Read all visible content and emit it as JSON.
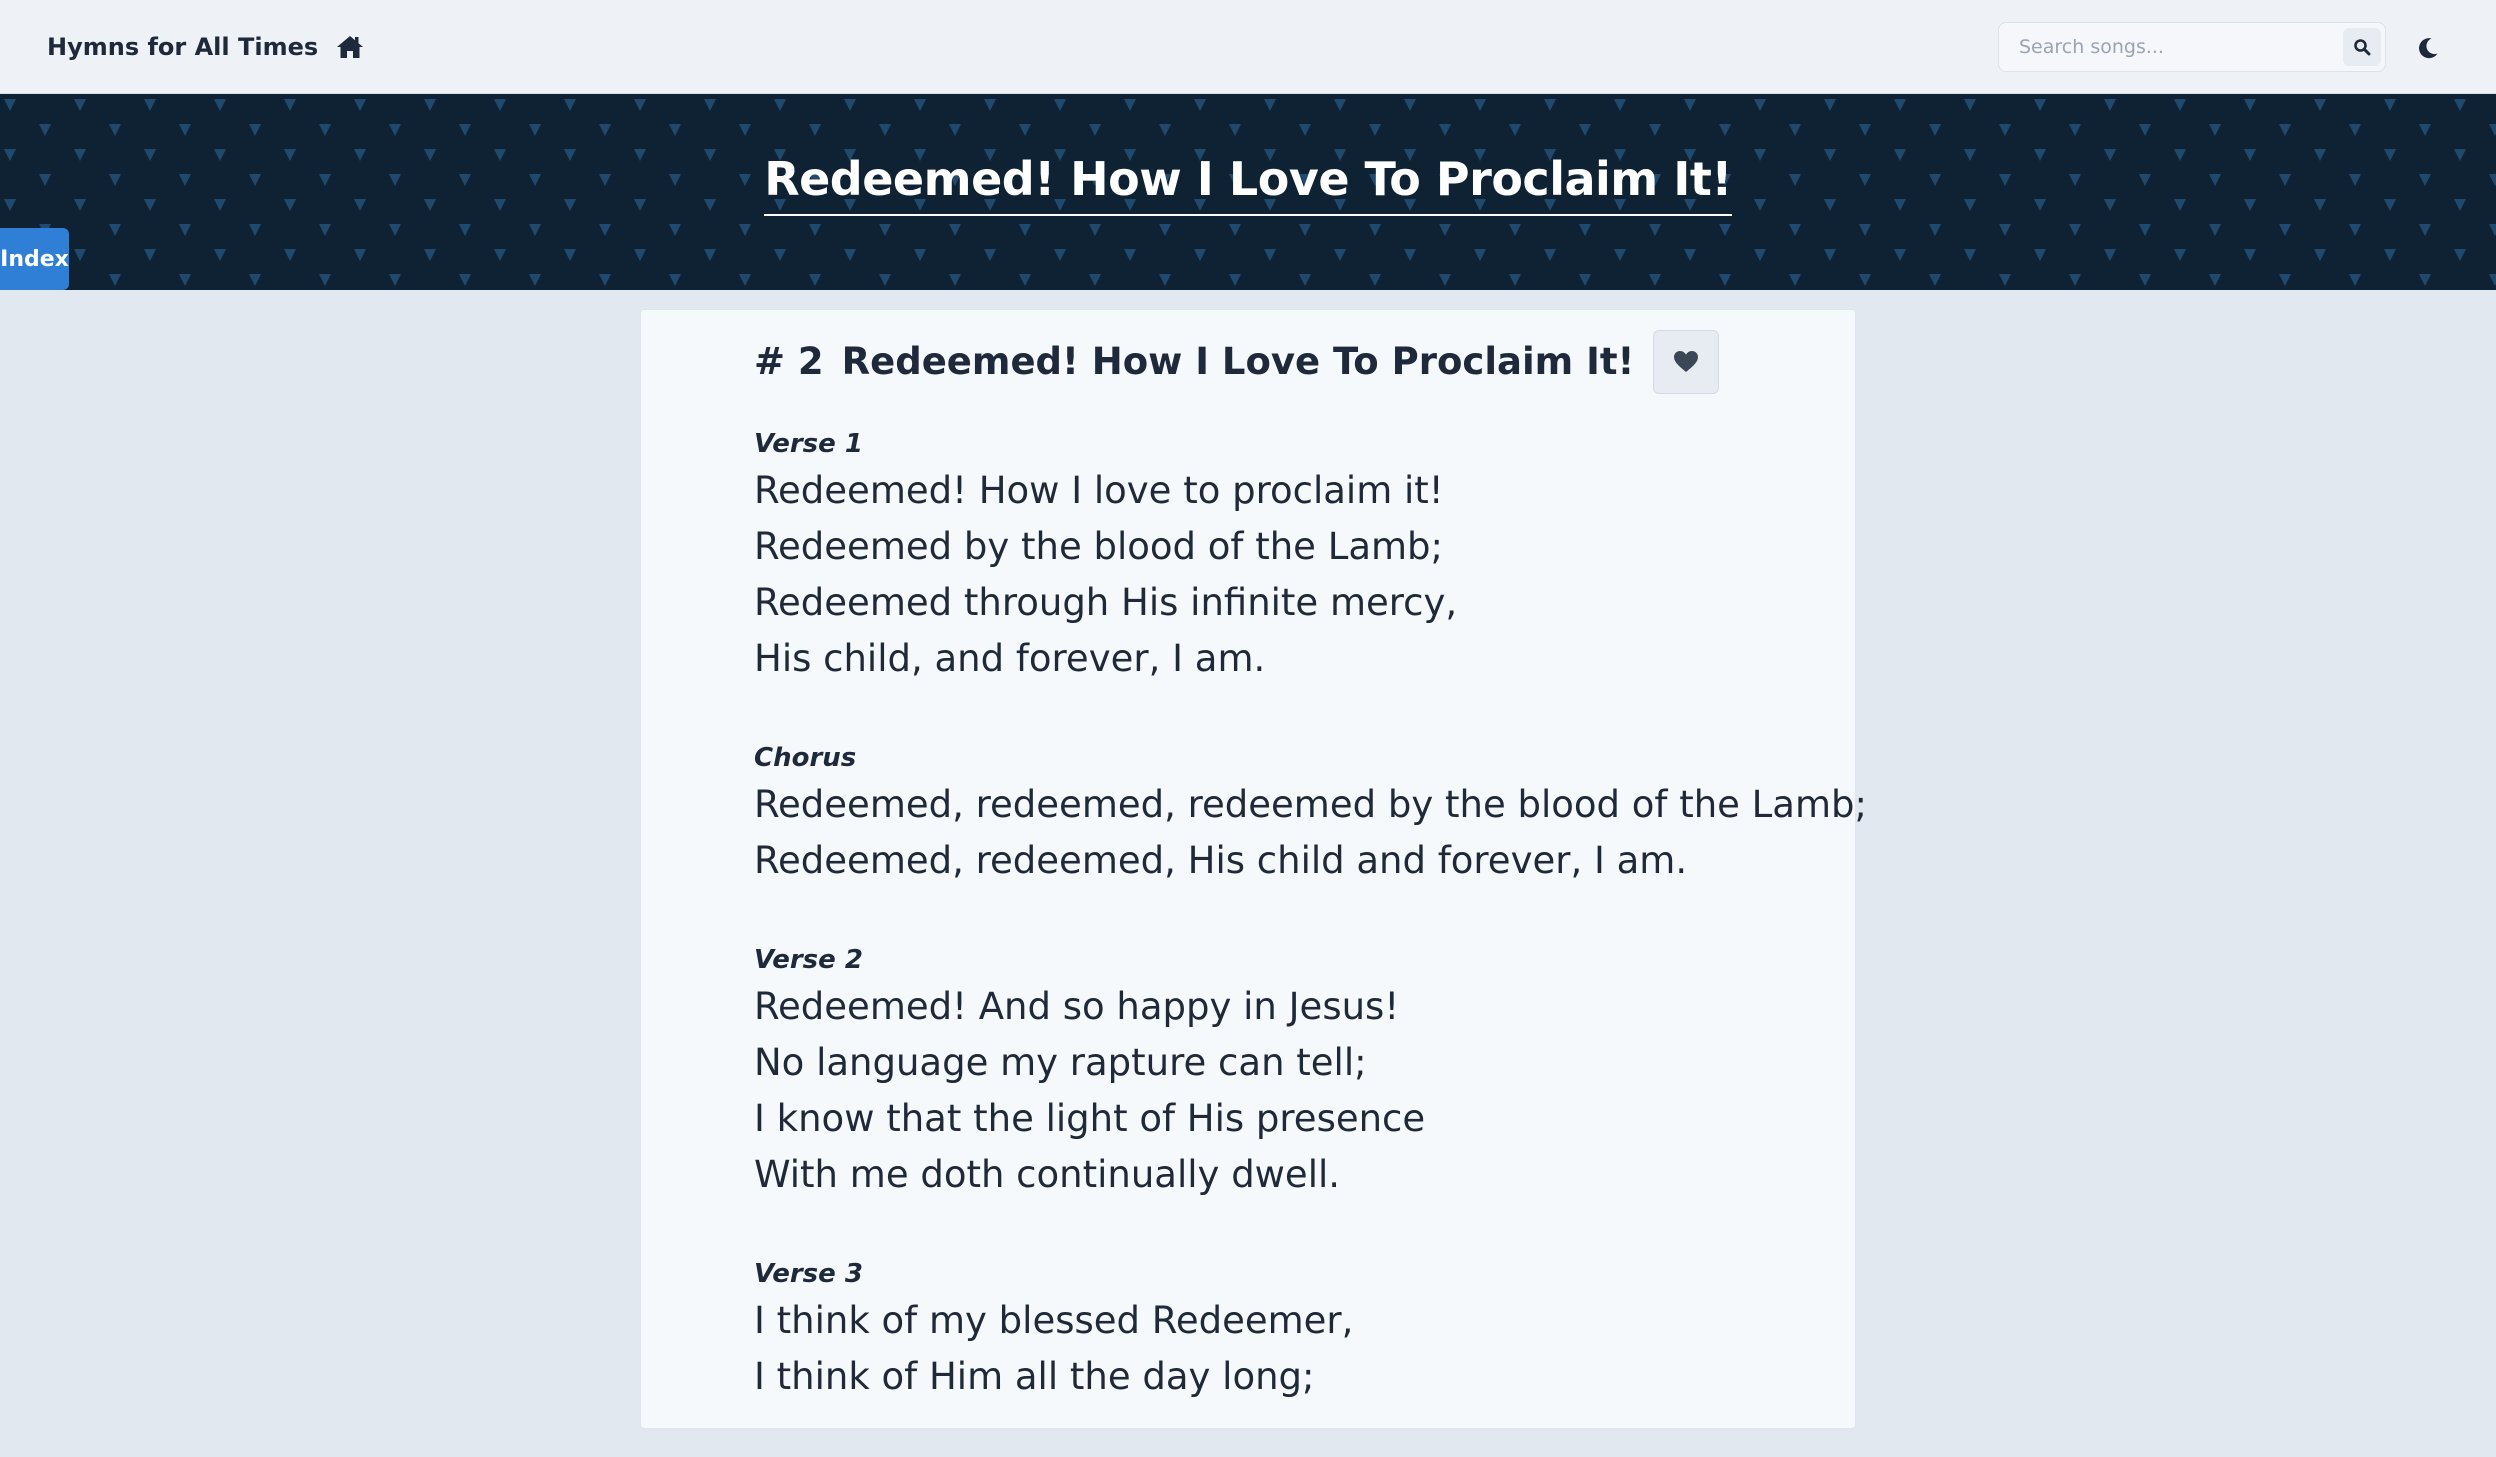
{
  "navbar": {
    "brand": "Hymns for All Times",
    "brand_icon": "home-icon",
    "search_placeholder": "Search songs...",
    "search_icon": "search-icon",
    "theme_icon": "moon-icon"
  },
  "hero": {
    "title": "Redeemed! How I Love To Proclaim It!",
    "index_label": "Index"
  },
  "song": {
    "number": "# 2",
    "title": "Redeemed! How I Love To Proclaim It!",
    "favorite_icon": "heart-icon",
    "sections": [
      {
        "label": "Verse 1",
        "lines": [
          "Redeemed! How I love to proclaim it!",
          "Redeemed by the blood of the Lamb;",
          "Redeemed through His infinite mercy,",
          "His child, and forever, I am."
        ]
      },
      {
        "label": "Chorus",
        "lines": [
          "Redeemed, redeemed, redeemed by the blood of the Lamb;",
          "Redeemed, redeemed, His child and forever, I am."
        ]
      },
      {
        "label": "Verse 2",
        "lines": [
          "Redeemed! And so happy in Jesus!",
          "No language my rapture can tell;",
          "I know that the light of His presence",
          "With me doth continually dwell."
        ]
      },
      {
        "label": "Verse 3",
        "lines": [
          "I think of my blessed Redeemer,",
          "I think of Him all the day long;"
        ]
      }
    ]
  },
  "colors": {
    "hero_background": "#0f2233",
    "index_tab": "#2f7fd6",
    "page_background": "#e2e8f0"
  }
}
